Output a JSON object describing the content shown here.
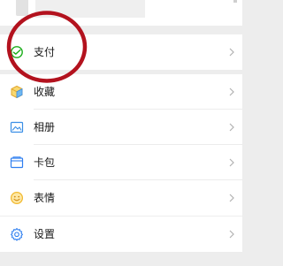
{
  "menu": {
    "pay": {
      "label": "支付",
      "icon": "wechat-pay-icon"
    },
    "favorites": {
      "label": "收藏",
      "icon": "favorites-cube-icon"
    },
    "album": {
      "label": "相册",
      "icon": "album-picture-icon"
    },
    "cards": {
      "label": "卡包",
      "icon": "card-wallet-icon"
    },
    "stickers": {
      "label": "表情",
      "icon": "sticker-smile-icon"
    },
    "settings": {
      "label": "设置",
      "icon": "settings-gear-icon"
    }
  },
  "colors": {
    "pay_green": "#1aad19",
    "favorites": "#f1c241",
    "album_blue": "#3a8ee6",
    "cards_blue": "#2f7ff0",
    "stickers_yellow": "#f1b82d",
    "settings_blue": "#2f7ff0",
    "annotation_red": "#b3121e"
  }
}
